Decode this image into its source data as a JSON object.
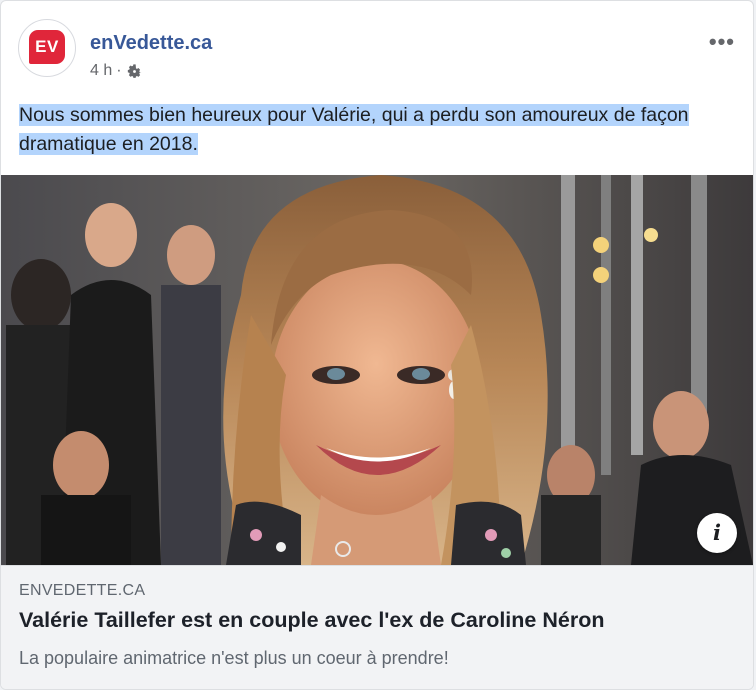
{
  "post": {
    "page_name": "enVedette.ca",
    "logo_text": "EV",
    "time": "4 h",
    "separator": "·",
    "privacy_icon": "gear-icon",
    "more_label": "•••",
    "text": "Nous sommes bien heureux pour Valérie, qui a perdu son amoureux de façon dramatique en 2018."
  },
  "link_preview": {
    "domain": "ENVEDETTE.CA",
    "title": "Valérie Taillefer est en couple avec l'ex de Caroline Néron",
    "description": "La populaire animatrice n'est plus un coeur à prendre!",
    "info_label": "i"
  },
  "colors": {
    "brand": "#e0263a",
    "page_name": "#385898",
    "selection": "#b3d4fc"
  }
}
